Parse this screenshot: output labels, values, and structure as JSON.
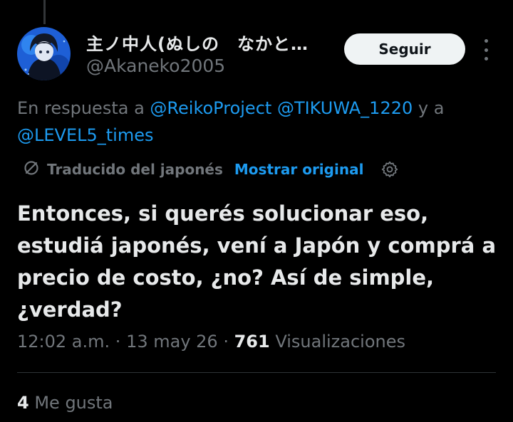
{
  "author": {
    "display_name": "主ノ中人(ぬしの　なかと…",
    "handle": "@Akaneko2005"
  },
  "follow_button": {
    "label": "Seguir"
  },
  "reply_to": {
    "prefix": "En respuesta a",
    "mention_1": "@ReikoProject",
    "mention_2": "@TIKUWA_1220",
    "conjunction": "y a",
    "mention_3": "@LEVEL5_times"
  },
  "translation": {
    "label": "Traducido del japonés",
    "show_original": "Mostrar original"
  },
  "tweet": {
    "text": "Entonces, si querés solucionar eso, estudiá japonés, vení a Japón y comprá a precio de costo, ¿no? Así de simple, ¿verdad?"
  },
  "meta": {
    "time": "12:02 a.m.",
    "sep1": "·",
    "date": "13 may 26",
    "sep2": "·",
    "views_count": "761",
    "views_label": "Visualizaciones"
  },
  "likes": {
    "count": "4",
    "label": "Me gusta"
  },
  "colors": {
    "background": "#000000",
    "text_primary": "#e7e9ea",
    "text_secondary": "#71767b",
    "link": "#1d9bf0",
    "button_bg": "#eff3f4"
  }
}
